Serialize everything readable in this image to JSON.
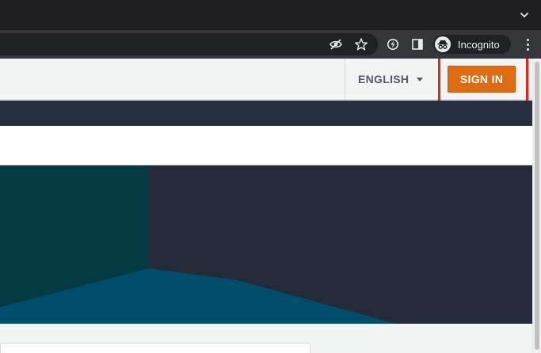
{
  "browser": {
    "incognito_label": "Incognito",
    "icons": [
      "chevron-down-icon",
      "eye-off-icon",
      "star-icon",
      "extension-icon",
      "side-panel-icon",
      "incognito-icon",
      "more-vert-icon"
    ]
  },
  "header": {
    "language_label": "ENGLISH",
    "signin_label": "SIGN IN"
  },
  "colors": {
    "brand_orange": "#dd6c13",
    "nav_dark": "#232f3e",
    "hero_teal": "#033a40",
    "hero_blue": "#004d6b",
    "highlight_red": "#e8231b"
  }
}
